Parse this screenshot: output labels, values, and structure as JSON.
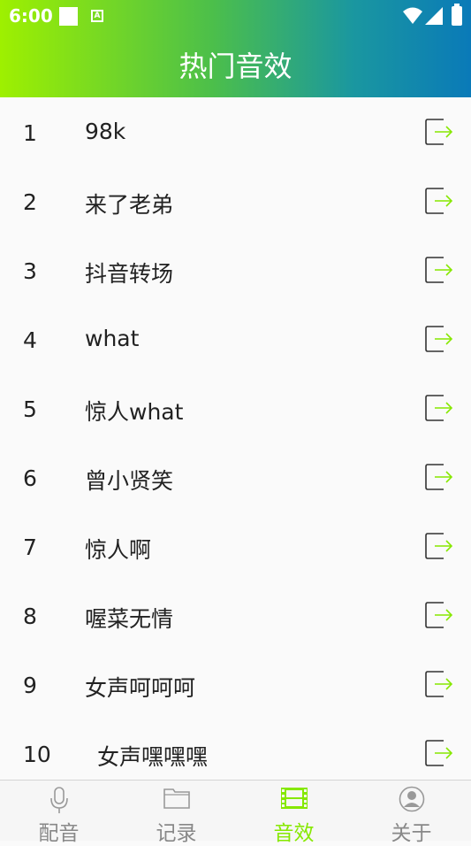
{
  "statusbar": {
    "time": "6:00",
    "a_icon": "A"
  },
  "header": {
    "title": "热门音效"
  },
  "items": [
    {
      "num": "1",
      "name": "98k"
    },
    {
      "num": "2",
      "name": "来了老弟"
    },
    {
      "num": "3",
      "name": "抖音转场"
    },
    {
      "num": "4",
      "name": "what"
    },
    {
      "num": "5",
      "name": "惊人what"
    },
    {
      "num": "6",
      "name": "曾小贤笑"
    },
    {
      "num": "7",
      "name": "惊人啊"
    },
    {
      "num": "8",
      "name": "喔菜无情"
    },
    {
      "num": "9",
      "name": "女声呵呵呵"
    },
    {
      "num": "10",
      "name": "女声嘿嘿嘿"
    }
  ],
  "tabs": [
    {
      "label": "配音",
      "icon": "microphone-icon"
    },
    {
      "label": "记录",
      "icon": "folder-icon"
    },
    {
      "label": "音效",
      "icon": "film-icon",
      "active": true
    },
    {
      "label": "关于",
      "icon": "person-icon"
    }
  ],
  "colors": {
    "accent": "#86e800",
    "header_start": "#9ef000",
    "header_end": "#0a7ab8"
  }
}
